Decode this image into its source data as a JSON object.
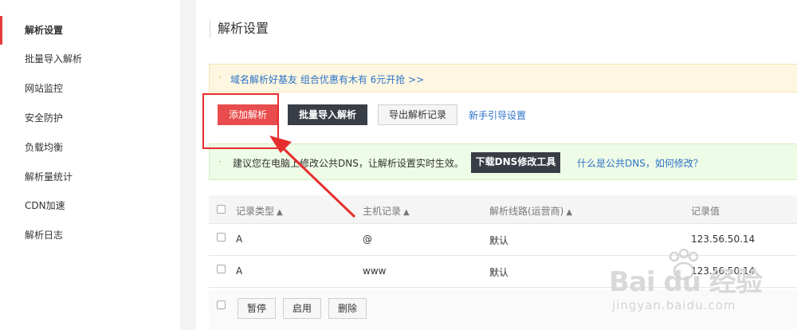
{
  "sidebar": {
    "items": [
      {
        "label": "解析设置",
        "active": true
      },
      {
        "label": "批量导入解析"
      },
      {
        "label": "网站监控"
      },
      {
        "label": "安全防护"
      },
      {
        "label": "负载均衡"
      },
      {
        "label": "解析量统计"
      },
      {
        "label": "CDN加速"
      },
      {
        "label": "解析日志"
      }
    ]
  },
  "main": {
    "title": "解析设置",
    "notice": {
      "bullet": "·",
      "text": "域名解析好基友 组合优惠有木有 6元开抢 >>"
    },
    "toolbar": {
      "add_label": "添加解析",
      "batch_label": "批量导入解析",
      "export_label": "导出解析记录",
      "guide_label": "新手引导设置"
    },
    "dns_tip": {
      "bullet": "·",
      "text": "建议您在电脑上修改公共DNS，让解析设置实时生效。",
      "button_label": "下载DNS修改工具",
      "link_label": "什么是公共DNS，如何修改？"
    },
    "table": {
      "columns": [
        "记录类型",
        "主机记录",
        "解析线路(运营商)",
        "记录值"
      ],
      "sort_icon": "▲",
      "rows": [
        {
          "type": "A",
          "host": "@",
          "line": "默认",
          "value": "123.56.50.14"
        },
        {
          "type": "A",
          "host": "www",
          "line": "默认",
          "value": "123.56.50.14"
        }
      ],
      "actions": {
        "pause": "暂停",
        "enable": "启用",
        "delete": "删除"
      }
    }
  },
  "watermark": {
    "brand": "Bai du 经验",
    "url": "jingyan.baidu.com"
  },
  "colors": {
    "accent_red": "#e84c4c",
    "dark_button": "#383d46",
    "link_blue": "#2d73c7"
  }
}
